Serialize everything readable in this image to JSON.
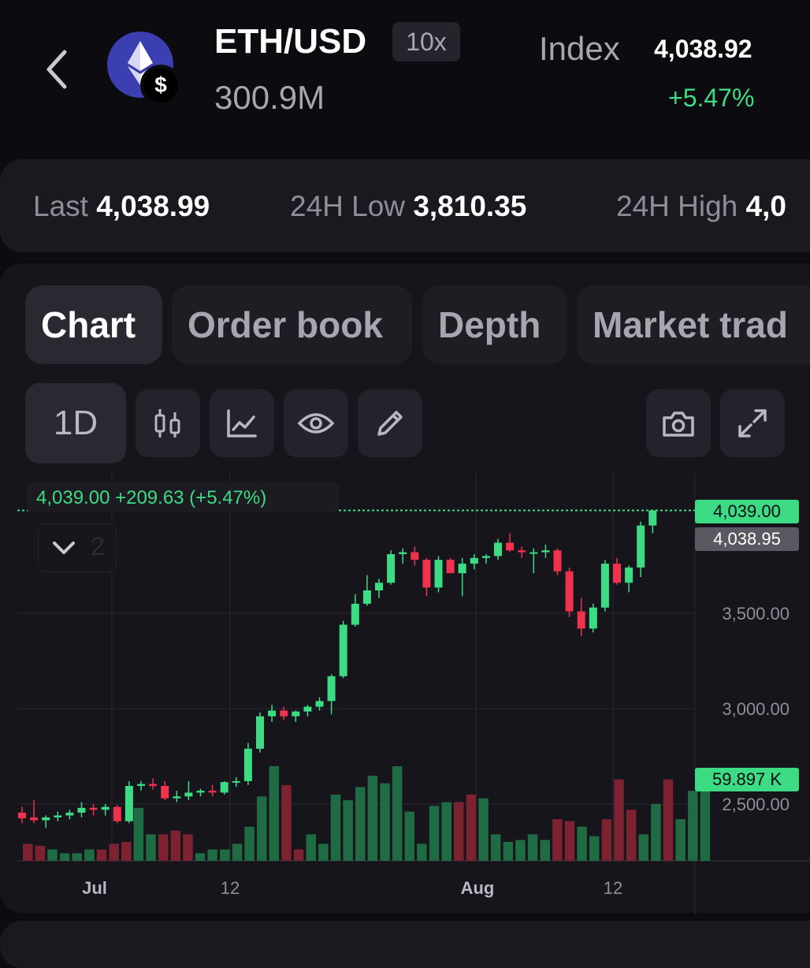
{
  "header": {
    "pair": "ETH/USD",
    "leverage": "10x",
    "volume": "300.9M",
    "index_label": "Index",
    "index_value": "4,038.92",
    "index_change": "+5.47%",
    "quote_badge": "$"
  },
  "stats": [
    {
      "label": "Last",
      "value": "4,038.99"
    },
    {
      "label": "24H Low",
      "value": "3,810.35"
    },
    {
      "label": "24H High",
      "value": "4,0"
    }
  ],
  "tabs": [
    {
      "label": "Chart",
      "active": true
    },
    {
      "label": "Order book",
      "active": false
    },
    {
      "label": "Depth",
      "active": false
    },
    {
      "label": "Market trad",
      "active": false
    }
  ],
  "toolbar": {
    "timeframe": "1D",
    "icons": [
      "candlestick-icon",
      "indicator-icon",
      "eye-icon",
      "pencil-icon",
      "camera-icon",
      "expand-icon"
    ]
  },
  "legend": {
    "text": "4,039.00  +209.63 (+5.47%)",
    "collapse_count": "2"
  },
  "colors": {
    "up": "#3ddc84",
    "down": "#f0324e",
    "background": "#0c0b10"
  },
  "chart_data": {
    "type": "candlestick",
    "price_axis_labels": [
      "3,500.00",
      "3,000.00",
      "2,500.00"
    ],
    "time_axis_labels": [
      "Jul",
      "12",
      "Aug",
      "12"
    ],
    "last_price_tag": "4,039.00",
    "index_price_tag": "4,038.95",
    "volume_tag": "59.897 K",
    "ylim": [
      2200,
      4300
    ],
    "candles": [
      [
        2455,
        2485,
        2400,
        2425
      ],
      [
        2430,
        2520,
        2400,
        2415
      ],
      [
        2415,
        2440,
        2375,
        2430
      ],
      [
        2430,
        2460,
        2410,
        2440
      ],
      [
        2440,
        2470,
        2420,
        2455
      ],
      [
        2455,
        2510,
        2430,
        2480
      ],
      [
        2480,
        2500,
        2440,
        2470
      ],
      [
        2470,
        2500,
        2440,
        2485
      ],
      [
        2485,
        2495,
        2400,
        2410
      ],
      [
        2410,
        2620,
        2400,
        2595
      ],
      [
        2595,
        2620,
        2570,
        2605
      ],
      [
        2605,
        2635,
        2575,
        2595
      ],
      [
        2595,
        2620,
        2520,
        2530
      ],
      [
        2530,
        2570,
        2510,
        2540
      ],
      [
        2540,
        2620,
        2520,
        2560
      ],
      [
        2560,
        2580,
        2540,
        2570
      ],
      [
        2570,
        2600,
        2540,
        2560
      ],
      [
        2560,
        2620,
        2550,
        2615
      ],
      [
        2615,
        2640,
        2590,
        2620
      ],
      [
        2620,
        2820,
        2600,
        2790
      ],
      [
        2790,
        2980,
        2770,
        2960
      ],
      [
        2960,
        3020,
        2930,
        2990
      ],
      [
        2990,
        3010,
        2940,
        2960
      ],
      [
        2960,
        2990,
        2930,
        2985
      ],
      [
        2985,
        3020,
        2960,
        3010
      ],
      [
        3010,
        3060,
        2990,
        3040
      ],
      [
        3040,
        3180,
        2970,
        3170
      ],
      [
        3170,
        3460,
        3160,
        3440
      ],
      [
        3440,
        3600,
        3430,
        3550
      ],
      [
        3550,
        3700,
        3540,
        3620
      ],
      [
        3620,
        3680,
        3580,
        3660
      ],
      [
        3660,
        3830,
        3650,
        3810
      ],
      [
        3810,
        3840,
        3760,
        3820
      ],
      [
        3820,
        3850,
        3750,
        3780
      ],
      [
        3780,
        3790,
        3590,
        3635
      ],
      [
        3635,
        3800,
        3610,
        3780
      ],
      [
        3780,
        3790,
        3720,
        3710
      ],
      [
        3710,
        3790,
        3590,
        3760
      ],
      [
        3760,
        3810,
        3730,
        3790
      ],
      [
        3790,
        3810,
        3760,
        3800
      ],
      [
        3800,
        3890,
        3780,
        3870
      ],
      [
        3870,
        3920,
        3820,
        3830
      ],
      [
        3830,
        3850,
        3790,
        3820
      ],
      [
        3820,
        3840,
        3710,
        3820
      ],
      [
        3820,
        3860,
        3790,
        3830
      ],
      [
        3830,
        3840,
        3700,
        3720
      ],
      [
        3720,
        3740,
        3480,
        3510
      ],
      [
        3510,
        3580,
        3380,
        3420
      ],
      [
        3420,
        3550,
        3400,
        3530
      ],
      [
        3530,
        3780,
        3510,
        3760
      ],
      [
        3760,
        3790,
        3650,
        3660
      ],
      [
        3660,
        3750,
        3610,
        3740
      ],
      [
        3740,
        3980,
        3690,
        3960
      ],
      [
        3960,
        4039,
        3920,
        4039
      ]
    ],
    "volumes": [
      [
        9,
        0
      ],
      [
        8,
        0
      ],
      [
        6,
        1
      ],
      [
        4,
        1
      ],
      [
        4,
        1
      ],
      [
        6,
        1
      ],
      [
        6,
        0
      ],
      [
        9,
        0
      ],
      [
        10,
        0
      ],
      [
        28,
        1
      ],
      [
        14,
        1
      ],
      [
        14,
        0
      ],
      [
        16,
        0
      ],
      [
        14,
        0
      ],
      [
        4,
        1
      ],
      [
        6,
        1
      ],
      [
        6,
        1
      ],
      [
        9,
        1
      ],
      [
        18,
        1
      ],
      [
        34,
        1
      ],
      [
        50,
        1
      ],
      [
        40,
        0
      ],
      [
        6,
        0
      ],
      [
        14,
        1
      ],
      [
        9,
        1
      ],
      [
        35,
        1
      ],
      [
        32,
        1
      ],
      [
        39,
        1
      ],
      [
        45,
        1
      ],
      [
        41,
        1
      ],
      [
        50,
        1
      ],
      [
        26,
        1
      ],
      [
        9,
        1
      ],
      [
        29,
        1
      ],
      [
        31,
        1
      ],
      [
        31,
        0
      ],
      [
        35,
        0
      ],
      [
        33,
        1
      ],
      [
        14,
        1
      ],
      [
        10,
        1
      ],
      [
        11,
        1
      ],
      [
        14,
        1
      ],
      [
        11,
        1
      ],
      [
        22,
        0
      ],
      [
        21,
        0
      ],
      [
        18,
        1
      ],
      [
        13,
        1
      ],
      [
        22,
        0
      ],
      [
        43,
        0
      ],
      [
        27,
        0
      ],
      [
        14,
        1
      ],
      [
        30,
        1
      ],
      [
        43,
        0
      ],
      [
        22,
        1
      ],
      [
        37,
        1
      ],
      [
        44,
        1
      ]
    ]
  }
}
